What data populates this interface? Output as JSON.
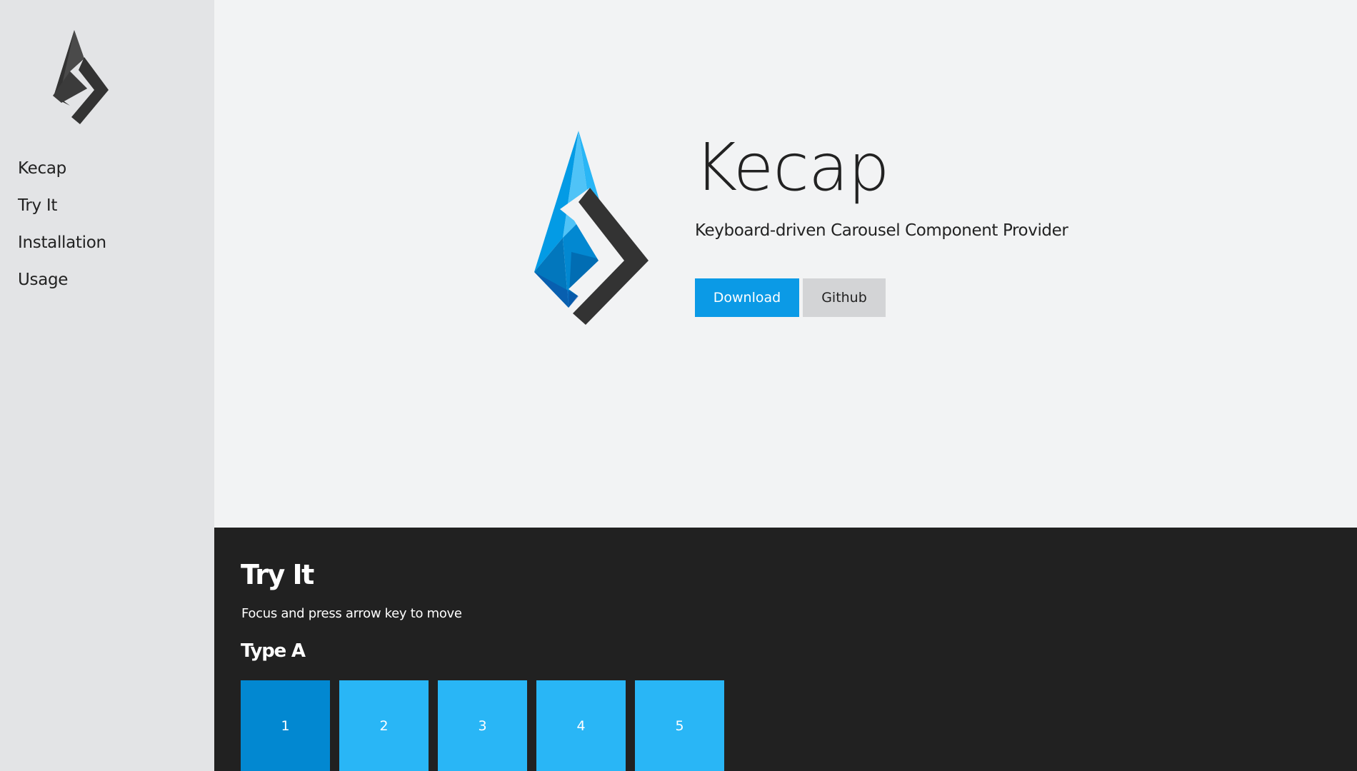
{
  "sidebar": {
    "items": [
      {
        "label": "Kecap"
      },
      {
        "label": "Try It"
      },
      {
        "label": "Installation"
      },
      {
        "label": "Usage"
      }
    ]
  },
  "hero": {
    "title": "Kecap",
    "subtitle": "Keyboard-driven Carousel Component Provider",
    "download_label": "Download",
    "github_label": "Github"
  },
  "tryit": {
    "title": "Try It",
    "description": "Focus and press arrow key to move",
    "type_a": {
      "title": "Type A",
      "slides": [
        "1",
        "2",
        "3",
        "4",
        "5"
      ],
      "active_index": 0
    }
  },
  "colors": {
    "accent": "#0b9ae6",
    "slide": "#29b6f6",
    "slide_active": "#0288d1",
    "dark": "#212121"
  }
}
